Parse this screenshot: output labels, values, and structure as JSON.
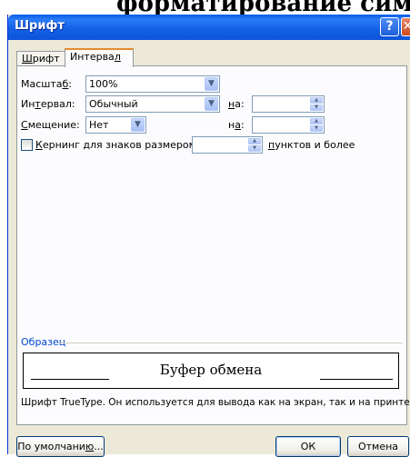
{
  "background": {
    "heading_fragment": "форматирование символов"
  },
  "window": {
    "title": "Шрифт",
    "help_glyph": "?",
    "close_glyph": "✕",
    "titlebar_color": "#0a5ee8"
  },
  "tabs": [
    {
      "label_pre": "",
      "label_ul": "Ш",
      "label_post": "рифт",
      "active": false
    },
    {
      "label_pre": "Интерва",
      "label_ul": "л",
      "label_post": "",
      "active": true
    }
  ],
  "fields": {
    "scale": {
      "label_pre": "Масшта",
      "label_ul": "б",
      "label_post": ":",
      "value": "100%"
    },
    "spacing": {
      "label_pre": "Ин",
      "label_ul": "т",
      "label_post": "ервал:",
      "value": "Обычный",
      "by_label_ul": "н",
      "by_label_post": "а:",
      "by_value": ""
    },
    "position": {
      "label_pre": "",
      "label_ul": "С",
      "label_post": "мещение:",
      "value": "Нет",
      "by_label_pre": "н",
      "by_label_ul": "а",
      "by_label_post": ":",
      "by_value": ""
    },
    "kerning": {
      "label_ul": "К",
      "label_post": "ернинг для знаков размером:",
      "value": "",
      "suffix_ul": "п",
      "suffix_post": "унктов и более",
      "checked": false
    }
  },
  "icons": {
    "dropdown_arrow": "chevron-down-icon",
    "spin_up": "spin-up-icon",
    "spin_down": "spin-down-icon",
    "dropdown_glyph": "▼",
    "up_glyph": "▲",
    "down_glyph": "▼"
  },
  "sample": {
    "legend": "Образец",
    "preview_text": "Буфер обмена",
    "description": "Шрифт TrueType. Он используется для вывода как на экран, так и на принтер."
  },
  "buttons": {
    "default_pre": "По умолчани",
    "default_ul": "ю",
    "default_post": "...",
    "ok": "ОК",
    "cancel": "Отмена"
  }
}
